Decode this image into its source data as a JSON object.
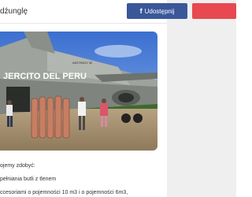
{
  "header": {
    "title": "dźunglę",
    "share_label": "Udostępnij",
    "share_icon": "facebook-icon"
  },
  "photo": {
    "plane_text": "JERCITO DEL PERU",
    "plane_small_text": "ANTONOV 32"
  },
  "body": {
    "line1": "ojemy zdobyć:",
    "line2": "pełniania butli z tlenem",
    "line3": "ccesoriami o pojemności 10 m3 i o pojemności 6m3,"
  },
  "colors": {
    "share_bg": "#3a579a",
    "second_button_bg": "#e8484f",
    "sidebar_bg": "#efefef"
  }
}
